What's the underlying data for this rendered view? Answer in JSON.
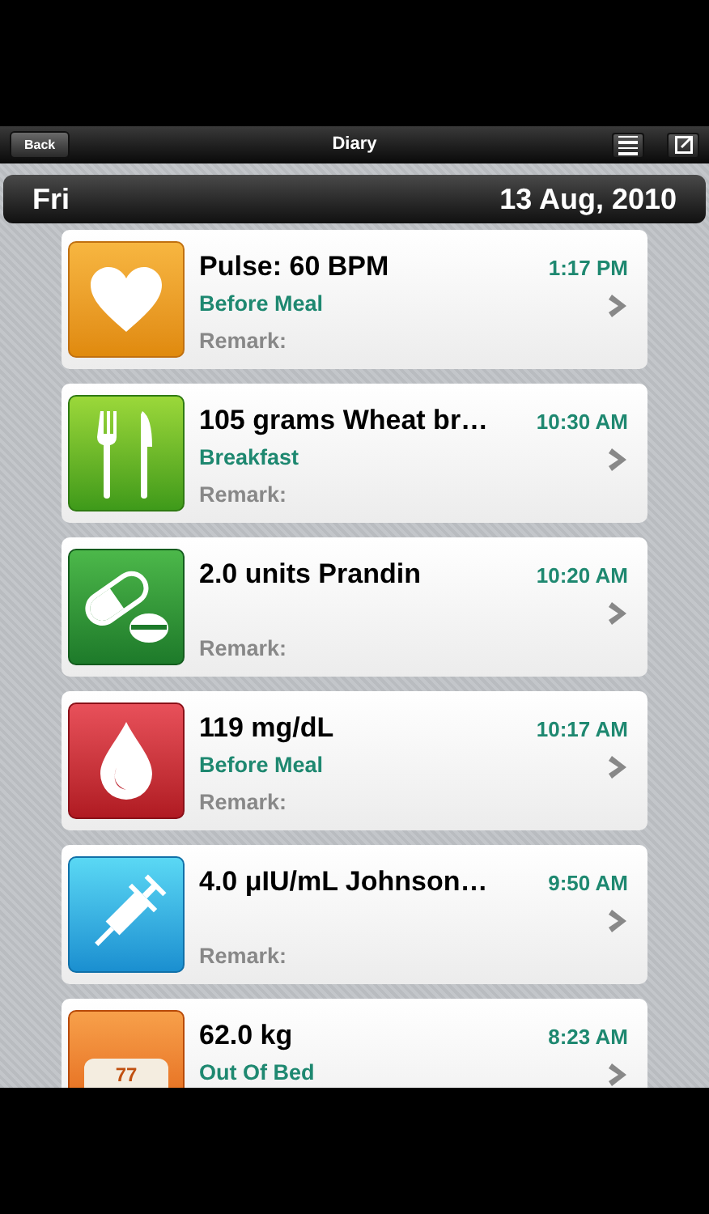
{
  "nav_bar": {
    "back_button": "Back",
    "title": "Diary"
  },
  "date_bar": {
    "weekday": "Fri",
    "date": "13 Aug, 2010"
  },
  "entries": [
    {
      "kind": "pulse",
      "title": "Pulse: 60 BPM",
      "time": "1:17 PM",
      "subtitle": "Before Meal",
      "remark": "Remark:"
    },
    {
      "kind": "food",
      "title": "105 grams Wheat br…",
      "time": "10:30 AM",
      "subtitle": "Breakfast",
      "remark": "Remark:"
    },
    {
      "kind": "medication",
      "title": "2.0 units Prandin",
      "time": "10:20 AM",
      "remark": "Remark:"
    },
    {
      "kind": "glucose",
      "title": "119 mg/dL",
      "time": "10:17 AM",
      "subtitle": "Before Meal",
      "remark": "Remark:"
    },
    {
      "kind": "insulin",
      "title": "4.0 μIU/mL Johnson…",
      "time": "9:50 AM",
      "remark": "Remark:"
    },
    {
      "kind": "weight",
      "title": "62.0 kg",
      "time": "8:23 AM",
      "subtitle": "Out Of Bed",
      "icon_text": "77"
    }
  ]
}
